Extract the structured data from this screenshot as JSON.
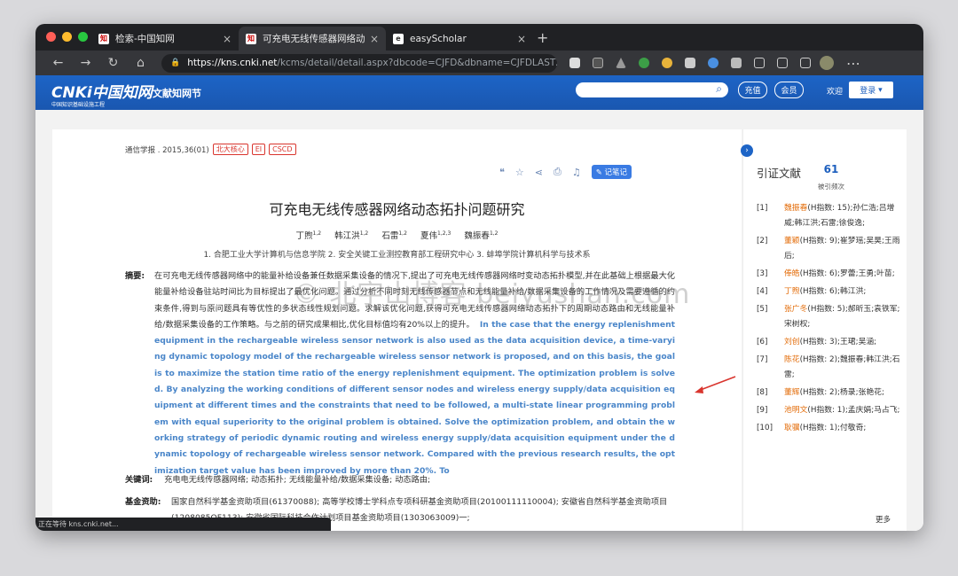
{
  "browser": {
    "tabs": [
      {
        "label": "检索-中国知网",
        "close": "×"
      },
      {
        "label": "可充电无线传感器网络动态拓扑",
        "close": "×"
      },
      {
        "label": "easyScholar",
        "close": "×"
      }
    ],
    "new_tab": "+",
    "url_domain": "https://kns.cnki.net",
    "url_path": "/kcms/detail/detail.aspx?dbcode=CJFD&dbname=CJFDLAST201...",
    "status": "正在等待 kns.cnki.net..."
  },
  "header": {
    "logo": "CNKi中国知网",
    "logo_sub": "中国知识基础设施工程",
    "site_name": "文献知网节",
    "recharge": "充值",
    "member": "会员",
    "welcome": "欢迎",
    "login": "登录"
  },
  "article": {
    "journal": "通信学报 . 2015,36(01)",
    "badges": [
      "北大核心",
      "EI",
      "CSCD"
    ],
    "note_button": "记笔记",
    "title": "可充电无线传感器网络动态拓扑问题研究",
    "authors": [
      {
        "name": "丁煦",
        "sup": "1,2"
      },
      {
        "name": "韩江洪",
        "sup": "1,2"
      },
      {
        "name": "石雷",
        "sup": "1,2"
      },
      {
        "name": "夏伟",
        "sup": "1,2,3"
      },
      {
        "name": "魏振春",
        "sup": "1,2"
      }
    ],
    "affiliations": "1. 合肥工业大学计算机与信息学院   2. 安全关键工业测控教育部工程研究中心   3. 蚌埠学院计算机科学与技术系",
    "abstract_label": "摘要:",
    "abstract_cn": "在可充电无线传感器网络中的能量补给设备兼任数据采集设备的情况下,提出了可充电无线传感器网络时变动态拓扑模型,并在此基础上根据最大化能量补给设备驻站时间比为目标提出了最优化问题。通过分析不同时刻无线传感器节点和无线能量补给/数据采集设备的工作情况及需要遵循的约束条件,得到与原问题具有等优性的多状态线性规划问题。求解该优化问题,获得可充电无线传感器网络动态拓扑下的周期动态路由和无线能量补给/数据采集设备的工作策略。与之前的研究成果相比,优化目标值均有20%以上的提升。",
    "abstract_en": "In the case that the energy replenishment equipment in the rechargeable wireless sensor network is also used as the data acquisition device, a time-varying dynamic topology model of the rechargeable wireless sensor network is proposed, and on this basis, the goal is to maximize the station time ratio of the energy replenishment equipment. The optimization problem is solved. By analyzing the working conditions of different sensor nodes and wireless energy supply/data acquisition equipment at different times and the constraints that need to be followed, a multi-state linear programming problem with equal superiority to the original problem is obtained. Solve the optimization problem, and obtain the working strategy of periodic dynamic routing and wireless energy supply/data acquisition equipment under the dynamic topology of rechargeable wireless sensor network. Compared with the previous research results, the optimization target value has been improved by more than 20%. To",
    "keywords_label": "关键词:",
    "keywords": "充电电无线传感器网络;  动态拓扑;  无线能量补给/数据采集设备;  动态路由;",
    "fund_label": "基金资助:",
    "fund": "国家自然科学基金资助项目(61370088);  高等学校博士学科点专项科研基金资助项目(20100111110004);  安徽省自然科学基金资助项目(1208085QF113);  安徽省国际科技合作计划项目基金资助项目(1303063009)一;"
  },
  "citations": {
    "heading": "引证文献",
    "count": "61",
    "count_label": "被引频次",
    "more": "更多",
    "items": [
      {
        "idx": "[1]",
        "name": "魏振春",
        "h": "(H指数: 15)",
        "rest": ";孙仁浩;吕增威;韩江洪;石雷;徐俊逸;"
      },
      {
        "idx": "[2]",
        "name": "董颖",
        "h": "(H指数: 9)",
        "rest": ";崔梦瑶;吴昊;王雨后;"
      },
      {
        "idx": "[3]",
        "name": "俸皓",
        "h": "(H指数: 6)",
        "rest": ";罗蕾;王勇;叶苗;"
      },
      {
        "idx": "[4]",
        "name": "丁煦",
        "h": "(H指数: 6)",
        "rest": ";韩江洪;"
      },
      {
        "idx": "[5]",
        "name": "张广冬",
        "h": "(H指数: 5)",
        "rest": ";郝昕玉;袁铁军;宋树权;"
      },
      {
        "idx": "[6]",
        "name": "刘创",
        "h": "(H指数: 3)",
        "rest": ";王珺;吴涵;"
      },
      {
        "idx": "[7]",
        "name": "陈花",
        "h": "(H指数: 2)",
        "rest": ";魏振春;韩江洪;石雷;"
      },
      {
        "idx": "[8]",
        "name": "董辉",
        "h": "(H指数: 2)",
        "rest": ";杨录;张艳花;"
      },
      {
        "idx": "[9]",
        "name": "池明文",
        "h": "(H指数: 1)",
        "rest": ";孟庆娟;马占飞;"
      },
      {
        "idx": "[10]",
        "name": "耿骥",
        "h": "(H指数: 1)",
        "rest": ";付敬奇;"
      }
    ]
  },
  "watermark": "© 北宇山博客 beiyushan.com"
}
